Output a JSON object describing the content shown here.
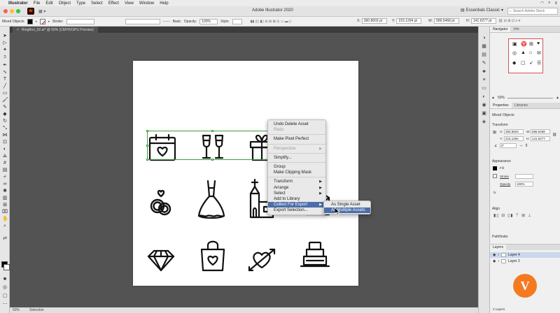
{
  "menubar": {
    "app": "Illustrator",
    "items": [
      "File",
      "Edit",
      "Object",
      "Type",
      "Select",
      "Effect",
      "View",
      "Window",
      "Help"
    ]
  },
  "appbar": {
    "title": "Adobe Illustrator 2020",
    "workspace": "Essentials Classic",
    "search_placeholder": "Search Adobe Stock"
  },
  "controlbar": {
    "mode": "Mixed Objects",
    "stroke_label": "Stroke:",
    "brush": "Basic",
    "opacity_label": "Opacity:",
    "opacity_value": "100%",
    "style_label": "Style:",
    "x_label": "X:",
    "x_value": "360.8603 pt",
    "y_label": "Y:",
    "y_value": "215.1294 pt",
    "w_label": "W:",
    "w_value": "586.5468 pt",
    "h_label": "H:",
    "h_value": "141.6277 pt"
  },
  "document": {
    "tab": "RingBox_02.ai* @ 50% (CMYK/GPU Preview)"
  },
  "statusbar": {
    "zoom": "50%",
    "tool": "Selection"
  },
  "context_menu": {
    "items": [
      {
        "label": "Undo Delete Asset",
        "disabled": false,
        "submenu": false
      },
      {
        "label": "Redo",
        "disabled": true,
        "submenu": false
      },
      {
        "sep": true
      },
      {
        "label": "Make Pixel Perfect",
        "disabled": false,
        "submenu": false
      },
      {
        "sep": true
      },
      {
        "label": "Perspective",
        "disabled": true,
        "submenu": true
      },
      {
        "sep": true
      },
      {
        "label": "Simplify...",
        "disabled": false,
        "submenu": false
      },
      {
        "sep": true
      },
      {
        "label": "Group",
        "disabled": false,
        "submenu": false
      },
      {
        "label": "Make Clipping Mask",
        "disabled": false,
        "submenu": false
      },
      {
        "sep": true
      },
      {
        "label": "Transform",
        "disabled": false,
        "submenu": true
      },
      {
        "label": "Arrange",
        "disabled": false,
        "submenu": true
      },
      {
        "label": "Select",
        "disabled": false,
        "submenu": true
      },
      {
        "label": "Add to Library",
        "disabled": false,
        "submenu": false
      },
      {
        "label": "Collect For Export",
        "disabled": false,
        "submenu": true,
        "active": true
      },
      {
        "label": "Export Selection...",
        "disabled": false,
        "submenu": false
      }
    ],
    "submenu_items": [
      {
        "label": "As Single Asset",
        "active": false
      },
      {
        "label": "As Multiple Assets",
        "active": true
      }
    ]
  },
  "panels": {
    "navigator_tab": "Navigator",
    "info_tab": "Info",
    "nav_zoom": "50%",
    "properties_tab": "Properties",
    "libraries_tab": "Libraries",
    "selection_kind": "Mixed Objects",
    "transform_title": "Transform",
    "x_label": "X:",
    "x_value": "360.8603",
    "y_label": "Y:",
    "y_value": "215.1294",
    "w_label": "W:",
    "w_value": "586.5468",
    "h_label": "H:",
    "h_value": "141.6277",
    "angle_value": "0°",
    "appearance_title": "Appearance",
    "fill_label": "Fill",
    "stroke_label": "Stroke",
    "opacity_label": "Opacity",
    "opacity_value": "100%",
    "fx_label": "fx.",
    "align_title": "Align",
    "pathfinder_title": "Pathfinder",
    "layers_tab": "Layers",
    "layers": [
      {
        "name": "Layer 4",
        "selected": true
      },
      {
        "name": "Layer 2",
        "selected": false
      }
    ],
    "layers_count": "2 Layers"
  },
  "colors": {
    "selection": "#3c9e3c",
    "menu_highlight": "#4c6ea8",
    "canvas_bg": "#535353",
    "watermark": "#f47a20"
  },
  "watermark": {
    "glyph": "V"
  }
}
